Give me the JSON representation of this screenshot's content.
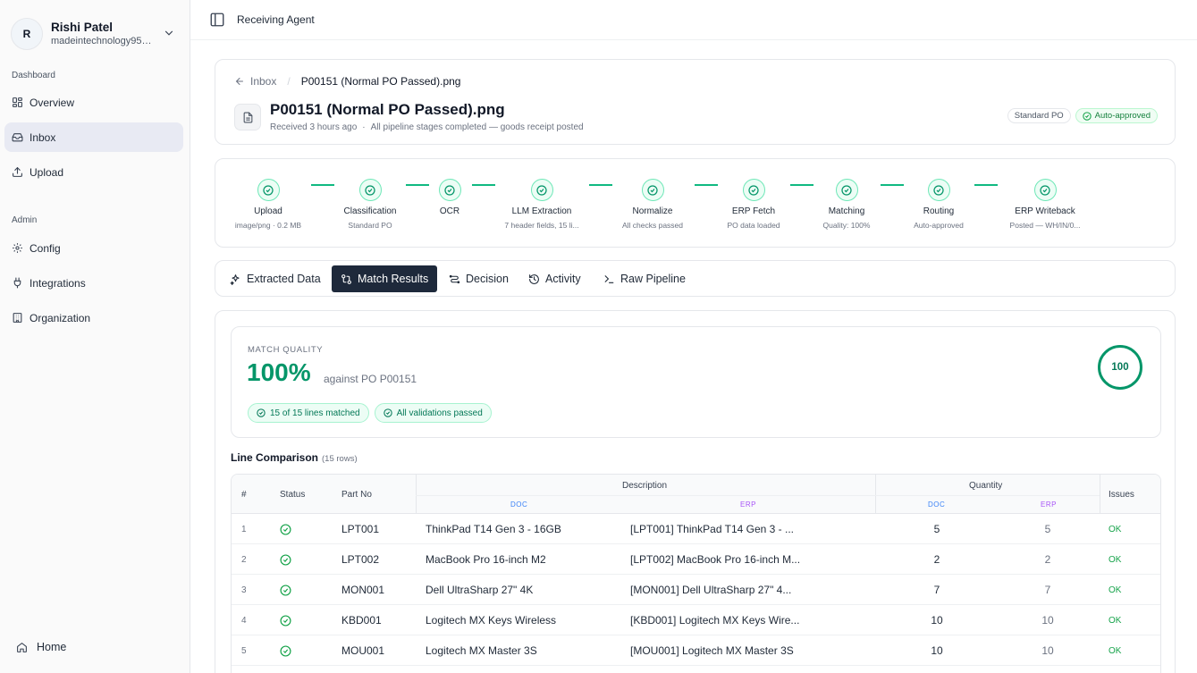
{
  "user": {
    "initial": "R",
    "name": "Rishi Patel",
    "email": "madeintechnology95@..."
  },
  "sidebar": {
    "dashboard_label": "Dashboard",
    "dashboard_items": [
      {
        "label": "Overview",
        "icon": "grid-icon"
      },
      {
        "label": "Inbox",
        "icon": "inbox-icon",
        "active": true
      },
      {
        "label": "Upload",
        "icon": "upload-icon"
      }
    ],
    "admin_label": "Admin",
    "admin_items": [
      {
        "label": "Config",
        "icon": "gear-icon"
      },
      {
        "label": "Integrations",
        "icon": "plug-icon"
      },
      {
        "label": "Organization",
        "icon": "building-icon"
      }
    ],
    "home_label": "Home"
  },
  "topbar": {
    "title": "Receiving Agent"
  },
  "header": {
    "back_label": "Inbox",
    "breadcrumb_current": "P00151 (Normal PO Passed).png",
    "title": "P00151 (Normal PO Passed).png",
    "received": "Received 3 hours ago",
    "separator": "·",
    "status_text": "All pipeline stages completed — goods receipt posted",
    "badge_type": "Standard PO",
    "badge_status": "Auto-approved"
  },
  "pipeline": [
    {
      "name": "Upload",
      "sub": "image/png · 0.2 MB"
    },
    {
      "name": "Classification",
      "sub": "Standard PO"
    },
    {
      "name": "OCR",
      "sub": ""
    },
    {
      "name": "LLM Extraction",
      "sub": "7 header fields, 15 li..."
    },
    {
      "name": "Normalize",
      "sub": "All checks passed"
    },
    {
      "name": "ERP Fetch",
      "sub": "PO data loaded"
    },
    {
      "name": "Matching",
      "sub": "Quality: 100%"
    },
    {
      "name": "Routing",
      "sub": "Auto-approved"
    },
    {
      "name": "ERP Writeback",
      "sub": "Posted — WH/IN/0..."
    }
  ],
  "tabs": [
    {
      "label": "Extracted Data",
      "icon": "sparkles-icon"
    },
    {
      "label": "Match Results",
      "icon": "git-compare-icon",
      "active": true
    },
    {
      "label": "Decision",
      "icon": "route-icon"
    },
    {
      "label": "Activity",
      "icon": "history-icon"
    },
    {
      "label": "Raw Pipeline",
      "icon": "terminal-icon"
    }
  ],
  "match": {
    "label": "MATCH QUALITY",
    "value": "100%",
    "against": "against PO P00151",
    "score": "100",
    "pill_lines": "15 of 15 lines matched",
    "pill_validations": "All validations passed"
  },
  "line_comparison": {
    "title": "Line Comparison",
    "rows_count": "(15 rows)",
    "headers": {
      "index": "#",
      "status": "Status",
      "part_no": "Part No",
      "description": "Description",
      "quantity": "Quantity",
      "issues": "Issues",
      "doc": "DOC",
      "erp": "ERP"
    },
    "rows": [
      {
        "n": "1",
        "part": "LPT001",
        "doc_desc": "ThinkPad T14 Gen 3 - 16GB",
        "erp_desc": "[LPT001] ThinkPad T14 Gen 3 - ...",
        "doc_qty": "5",
        "erp_qty": "5",
        "issue": "OK"
      },
      {
        "n": "2",
        "part": "LPT002",
        "doc_desc": "MacBook Pro 16-inch M2",
        "erp_desc": "[LPT002] MacBook Pro 16-inch M...",
        "doc_qty": "2",
        "erp_qty": "2",
        "issue": "OK"
      },
      {
        "n": "3",
        "part": "MON001",
        "doc_desc": "Dell UltraSharp 27\" 4K",
        "erp_desc": "[MON001] Dell UltraSharp 27\" 4...",
        "doc_qty": "7",
        "erp_qty": "7",
        "issue": "OK"
      },
      {
        "n": "4",
        "part": "KBD001",
        "doc_desc": "Logitech MX Keys Wireless",
        "erp_desc": "[KBD001] Logitech MX Keys Wire...",
        "doc_qty": "10",
        "erp_qty": "10",
        "issue": "OK"
      },
      {
        "n": "5",
        "part": "MOU001",
        "doc_desc": "Logitech MX Master 3S",
        "erp_desc": "[MOU001] Logitech MX Master 3S",
        "doc_qty": "10",
        "erp_qty": "10",
        "issue": "OK"
      }
    ]
  },
  "colors": {
    "accent_green": "#059669",
    "active_tab": "#1e293b",
    "sidebar_active": "#e8eaf3"
  }
}
